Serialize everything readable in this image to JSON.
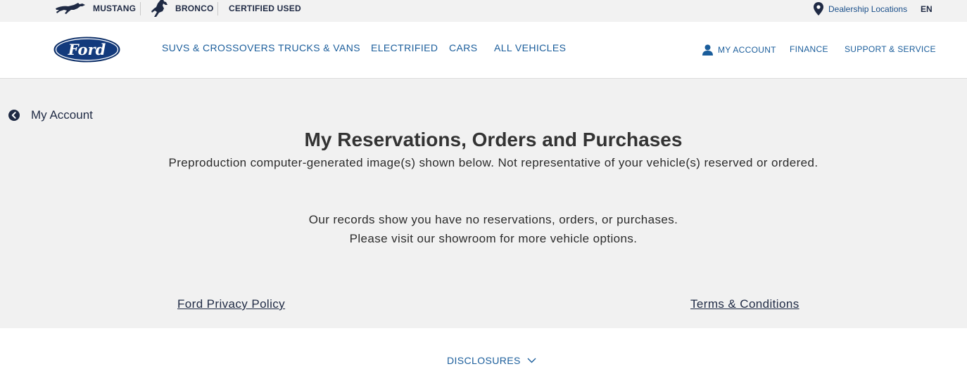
{
  "topbar": {
    "brands": [
      {
        "label": "MUSTANG",
        "icon": "mustang-pony-icon"
      },
      {
        "label": "BRONCO",
        "icon": "bronco-horse-icon"
      },
      {
        "label": "CERTIFIED USED"
      }
    ],
    "dealer_label": "Dealership Locations",
    "dealer_icon": "location-pin-icon",
    "language": "EN"
  },
  "nav": {
    "logo_text": "Ford",
    "items": [
      "SUVS & CROSSOVERS",
      "TRUCKS & VANS",
      "ELECTRIFIED",
      "CARS",
      "ALL VEHICLES"
    ],
    "account_label": "MY ACCOUNT",
    "account_icon": "user-icon",
    "finance_label": "FINANCE",
    "support_label": "SUPPORT & SERVICE"
  },
  "main": {
    "back_label": "My Account",
    "back_icon": "chevron-left-circle-icon",
    "title": "My Reservations, Orders and Purchases",
    "subtitle": "Preproduction computer-generated image(s) shown below. Not representative of your vehicle(s) reserved or ordered.",
    "empty_line1": "Our records show you have no reservations, orders, or purchases.",
    "empty_line2": "Please visit our showroom for more vehicle options.",
    "privacy_link": "Ford Privacy Policy",
    "terms_link": "Terms & Conditions"
  },
  "footer": {
    "disclosures_label": "DISCLOSURES",
    "disclosures_icon": "chevron-down-icon"
  },
  "colors": {
    "accent": "#1a5d9b",
    "brand_navy": "#1f2a44",
    "logo_blue": "#133a7c",
    "page_bg": "#f1f1f1"
  }
}
